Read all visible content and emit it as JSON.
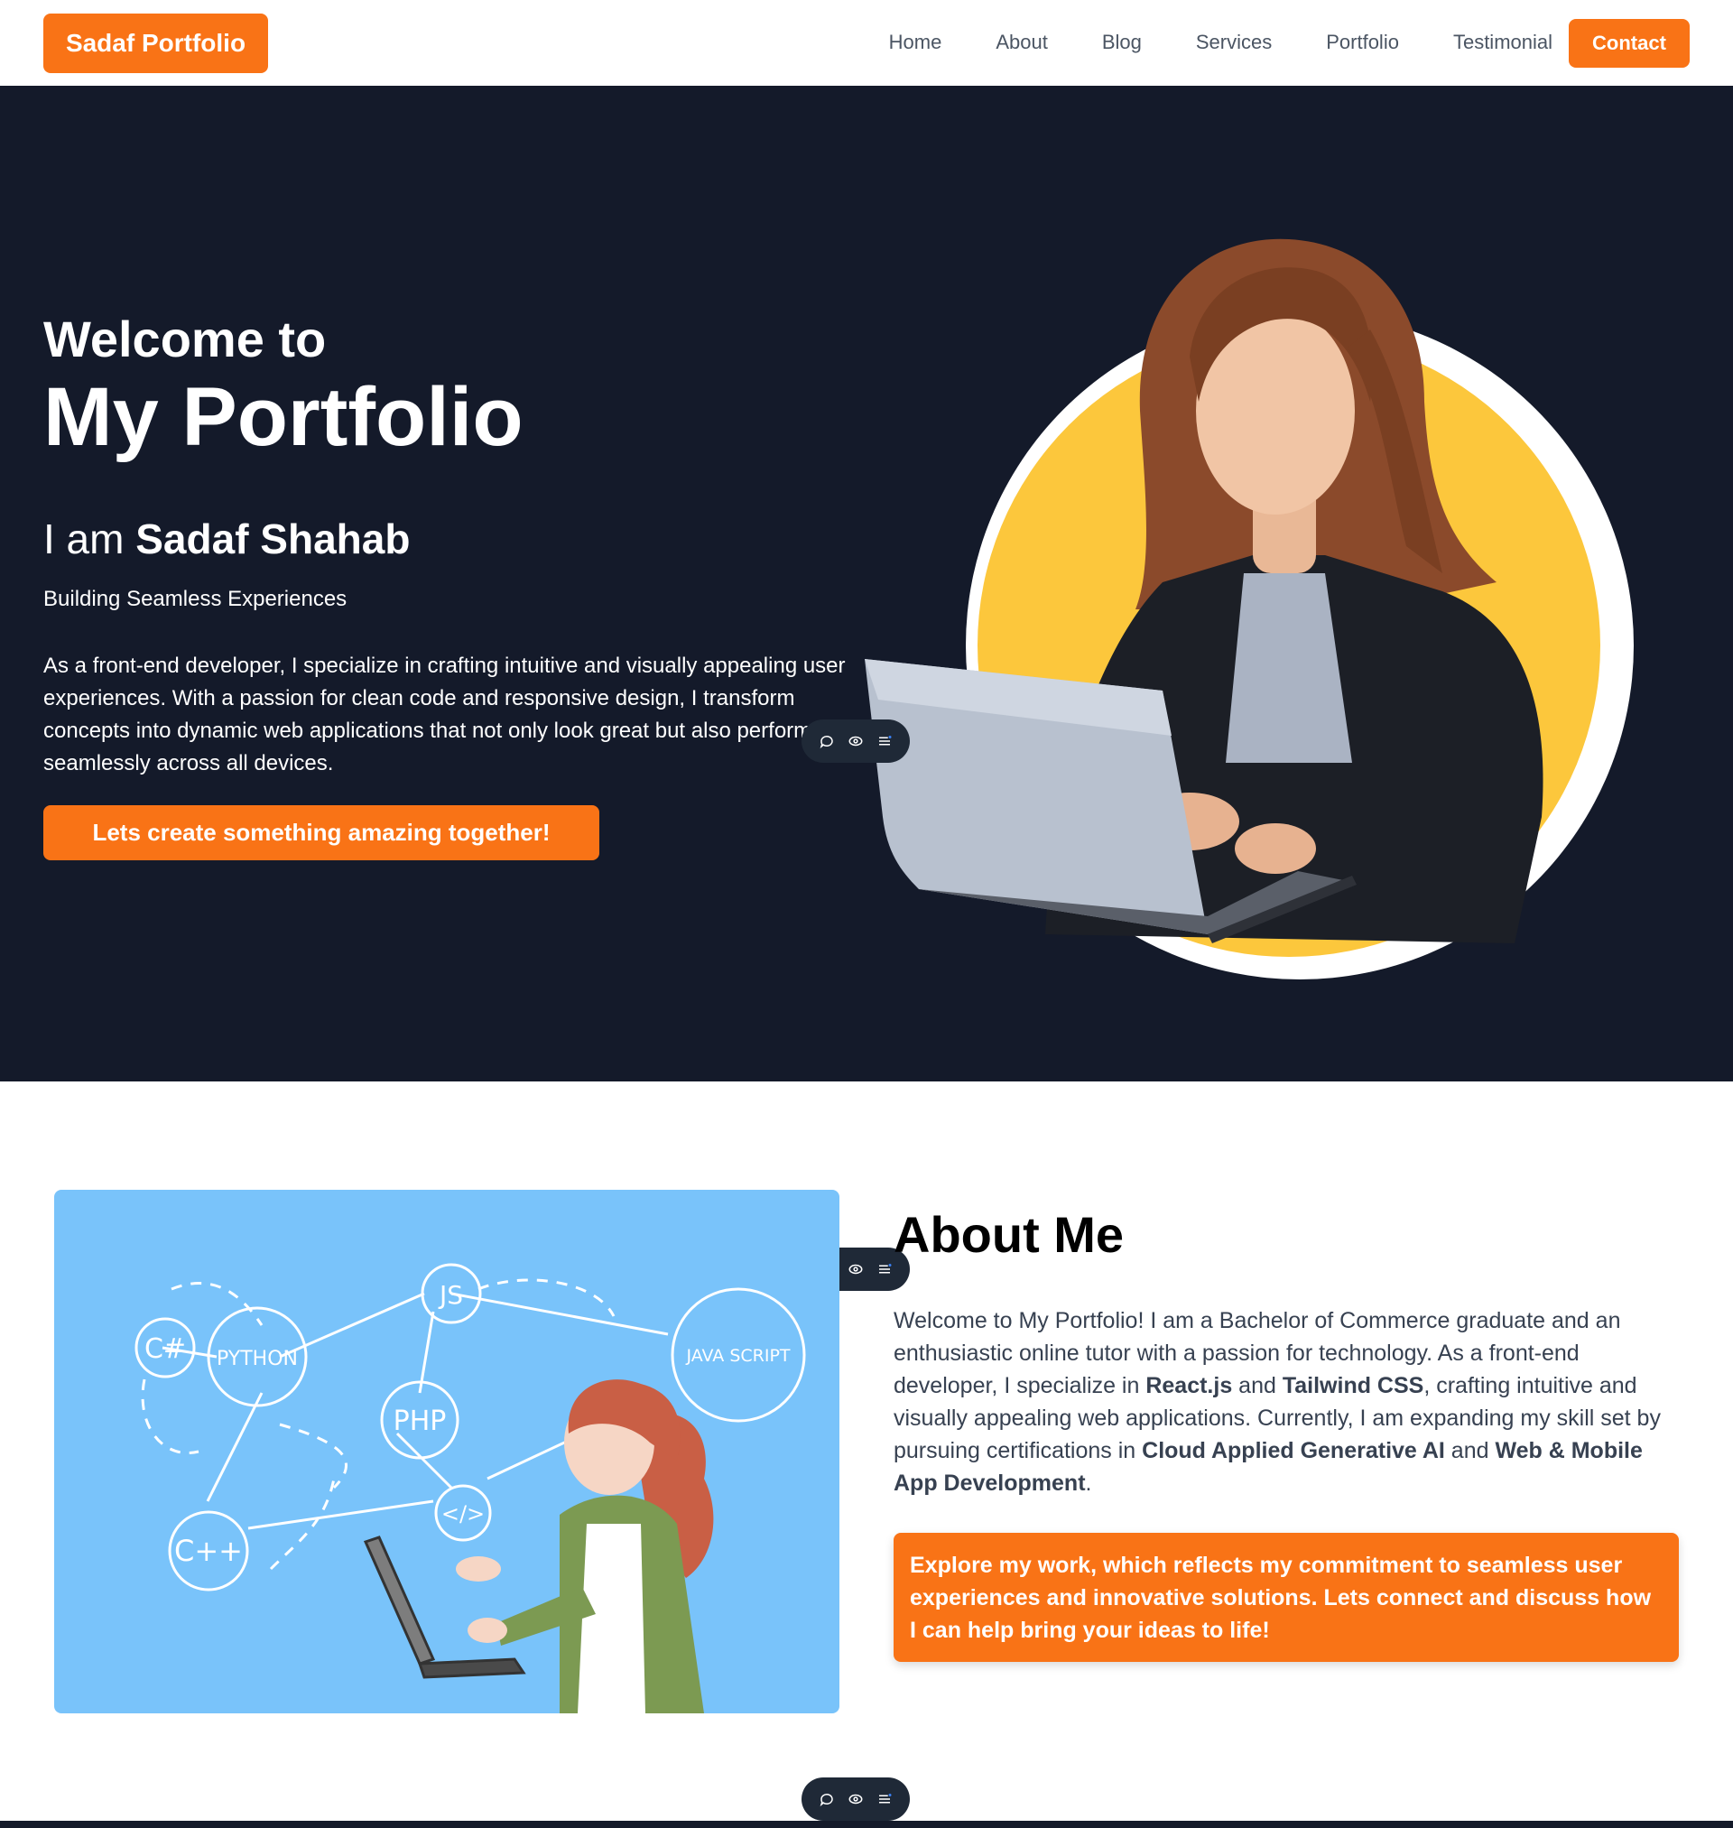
{
  "nav": {
    "brand": "Sadaf Portfolio",
    "links": [
      "Home",
      "About",
      "Blog",
      "Services",
      "Portfolio",
      "Testimonial"
    ],
    "contact": "Contact"
  },
  "hero": {
    "welcome": "Welcome to",
    "title": "My Portfolio",
    "iam_prefix": "I am ",
    "name": "Sadaf Shahab",
    "tagline": "Building Seamless Experiences",
    "description": "As a front-end developer, I specialize in crafting intuitive and visually appealing user experiences. With a passion for clean code and responsive design, I transform concepts into dynamic web applications that not only look great but also perform seamlessly across all devices.",
    "cta": "Lets create something amazing together!"
  },
  "about": {
    "title": "About Me",
    "text_1": "Welcome to My Portfolio! I am a Bachelor of Commerce graduate and an enthusiastic online tutor with a passion for technology. As a front-end developer, I specialize in ",
    "bold_1": "React.js",
    "text_2": " and ",
    "bold_2": "Tailwind CSS",
    "text_3": ", crafting intuitive and visually appealing web applications. Currently, I am expanding my skill set by pursuing certifications in ",
    "bold_3": "Cloud Applied Generative AI",
    "text_4": " and ",
    "bold_4": "Web & Mobile App Development",
    "text_5": ".",
    "cta": "Explore my work, which reflects my commitment to seamless user experiences and innovative solutions. Lets connect and discuss how I can help bring your ideas to life!",
    "illustration_labels": [
      "C#",
      "PYTHON",
      "JS",
      "JAVA SCRIPT",
      "PHP",
      "</>",
      "C++"
    ]
  },
  "colors": {
    "accent": "#f97316",
    "hero_bg": "#141a2a",
    "sun": "#fcc73c",
    "about_image_bg": "#79c3fa"
  },
  "icons": {
    "toolbar": [
      "comment-icon",
      "eye-icon",
      "list-icon"
    ]
  }
}
